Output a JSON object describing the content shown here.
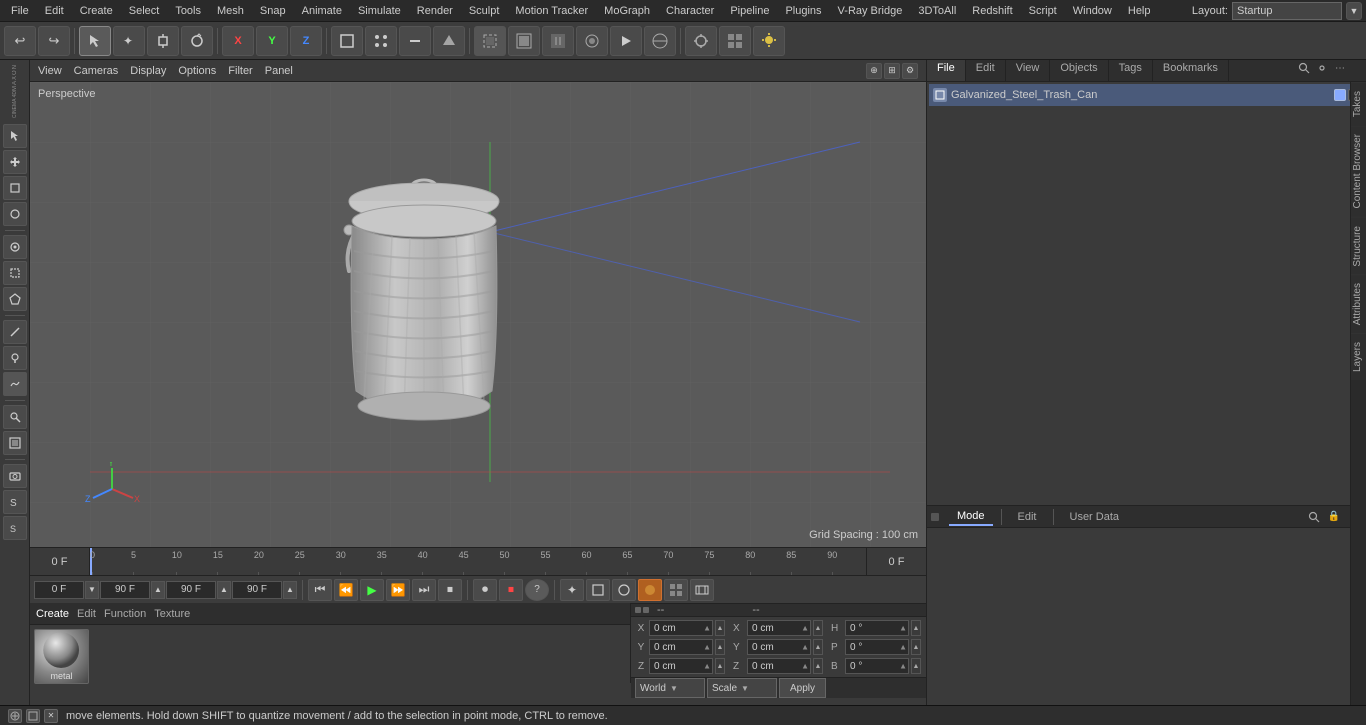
{
  "menu": {
    "items": [
      "File",
      "Edit",
      "Create",
      "Select",
      "Tools",
      "Mesh",
      "Snap",
      "Animate",
      "Simulate",
      "Render",
      "Sculpt",
      "Motion Tracker",
      "MoGraph",
      "Character",
      "Pipeline",
      "Plugins",
      "V-Ray Bridge",
      "3DToAll",
      "Redshift",
      "Script",
      "Window",
      "Help"
    ],
    "layout_label": "Layout:",
    "layout_value": "Startup"
  },
  "toolbar": {
    "buttons": [
      "↩",
      "↪",
      "✦",
      "+",
      "↺",
      "◎",
      "✦",
      "⬡",
      "▶",
      "⬢",
      "■",
      "▣",
      "⬟",
      "◉",
      "▦",
      "◷",
      "●"
    ]
  },
  "viewport": {
    "menu_items": [
      "View",
      "Cameras",
      "Display",
      "Options",
      "Filter",
      "Panel"
    ],
    "perspective_label": "Perspective",
    "grid_spacing": "Grid Spacing : 100 cm"
  },
  "timeline": {
    "start_frame": "0 F",
    "marks": [
      "0",
      "5",
      "10",
      "15",
      "20",
      "25",
      "30",
      "35",
      "40",
      "45",
      "50",
      "55",
      "60",
      "65",
      "70",
      "75",
      "80",
      "85",
      "90"
    ],
    "current_frame": "0 F",
    "end_frame": "90 F",
    "min_frame": "0 F",
    "max_frame": "90 F"
  },
  "transport": {
    "frame_field": "0 F",
    "start_field": "0 F",
    "end_field": "90 F",
    "min_field": "90 F"
  },
  "right_panel": {
    "tabs": [
      "File",
      "Edit",
      "View",
      "Objects",
      "Tags",
      "Bookmarks"
    ],
    "object_name": "Galvanized_Steel_Trash_Can",
    "vtabs": [
      "Takes",
      "Content Browser",
      "Structure",
      "Attributes",
      "Layers"
    ]
  },
  "attr_panel": {
    "tabs": [
      "Mode",
      "Edit",
      "User Data"
    ],
    "rows": [
      {
        "label": "X",
        "val1": "0 cm",
        "label2": "X",
        "val2": "0 cm",
        "label3": "H",
        "val3": "0 °"
      },
      {
        "label": "Y",
        "val1": "0 cm",
        "label2": "Y",
        "val2": "0 cm",
        "label3": "P",
        "val3": "0 °"
      },
      {
        "label": "Z",
        "val1": "0 cm",
        "label2": "Z",
        "val2": "0 cm",
        "label3": "B",
        "val3": "0 °"
      }
    ],
    "coord_headers": [
      "--",
      "--"
    ],
    "world_dropdown": "World",
    "scale_dropdown": "Scale",
    "apply_btn": "Apply"
  },
  "material_bar": {
    "tabs": [
      "Create",
      "Edit",
      "Function",
      "Texture"
    ],
    "material_name": "metal"
  },
  "status_bar": {
    "message": "move elements. Hold down SHIFT to quantize movement / add to the selection in point mode, CTRL to remove."
  },
  "sidebar": {
    "tools": [
      "⬡",
      "✦",
      "⬢",
      "⬟",
      "◈",
      "⬠",
      "◉",
      "⬣",
      "▦",
      "◷",
      "●",
      "◎",
      "✦",
      "+",
      "⬣"
    ]
  }
}
